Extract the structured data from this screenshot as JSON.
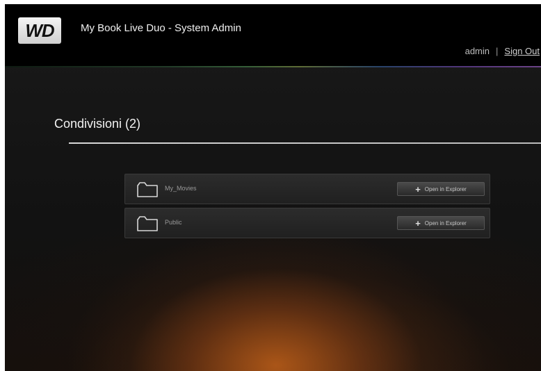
{
  "header": {
    "logo_text": "WD",
    "title": "My Book Live Duo - System Admin",
    "username": "admin",
    "separator": "|",
    "sign_out_label": "Sign Out"
  },
  "shares": {
    "title": "Condivisioni (2)",
    "items": [
      {
        "name": "My_Movies",
        "icon": "folder-icon",
        "action_label": "Open in Explorer",
        "action_icon": "plus-icon"
      },
      {
        "name": "Public",
        "icon": "folder-icon",
        "action_label": "Open in Explorer",
        "action_icon": "plus-icon"
      }
    ]
  },
  "colors": {
    "header_bg": "#000000",
    "page_bg": "#151515",
    "glow": "#be5f19"
  }
}
